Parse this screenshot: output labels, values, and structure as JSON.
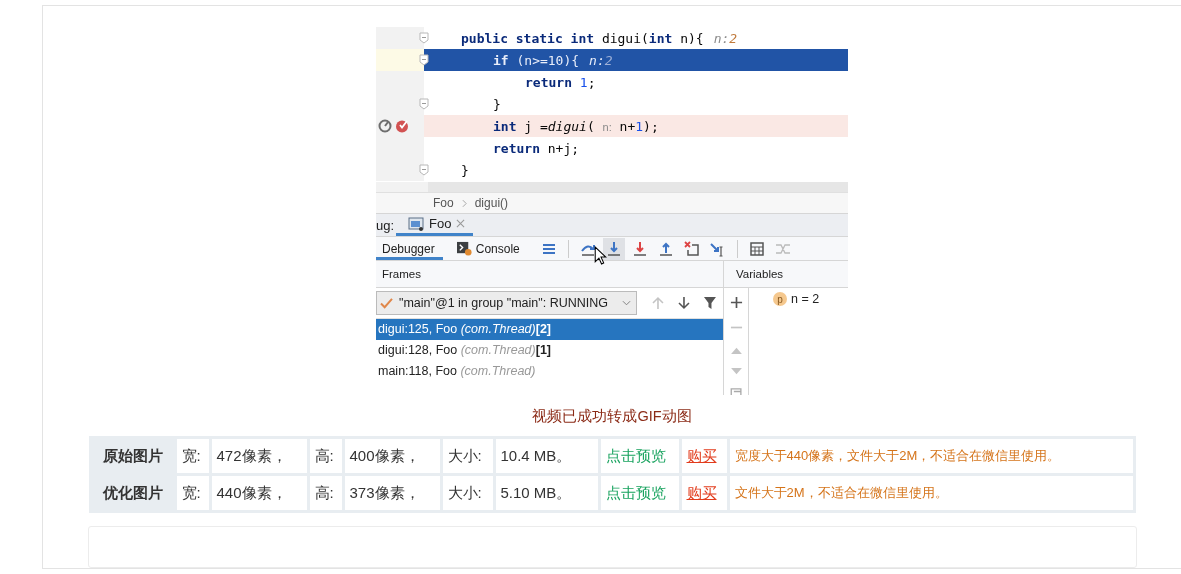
{
  "gif": {
    "code_lines": [
      {
        "current": false,
        "breakpoint": false,
        "fold": true,
        "segments": [
          {
            "kind": "kw",
            "text": "public static int"
          },
          {
            "kind": "plain",
            "text": " digui("
          },
          {
            "kind": "kw",
            "text": "int"
          },
          {
            "kind": "plain",
            "text": " n){"
          }
        ],
        "hint": [
          {
            "kind": "hint_name",
            "text": "n:"
          },
          {
            "kind": "hint_value",
            "text": "2"
          }
        ],
        "children": [
          {
            "current": true,
            "breakpoint": false,
            "fold": true,
            "segments": [
              {
                "kind": "kw",
                "text": "if"
              },
              {
                "kind": "plain",
                "text": " (n>=10){"
              }
            ],
            "hint": [
              {
                "kind": "hint_name",
                "text": "n:"
              },
              {
                "kind": "hint_value",
                "text": "2"
              }
            ],
            "children": [
              {
                "current": false,
                "breakpoint": false,
                "fold": false,
                "segments": [
                  {
                    "kind": "kw",
                    "text": "return"
                  },
                  {
                    "kind": "num",
                    "text": " 1"
                  },
                  {
                    "kind": "plain",
                    "text": ";"
                  }
                ]
              }
            ]
          },
          {
            "current": false,
            "breakpoint": false,
            "fold": true,
            "segments": [
              {
                "kind": "plain",
                "text": "}"
              }
            ]
          },
          {
            "current": false,
            "breakpoint": true,
            "fold": false,
            "segments": [
              {
                "kind": "kw",
                "text": "int"
              },
              {
                "kind": "plain",
                "text": " j ="
              },
              {
                "kind": "call",
                "text": "digui"
              },
              {
                "kind": "plain",
                "text": "( "
              },
              {
                "kind": "param",
                "text": "n:"
              },
              {
                "kind": "plain",
                "text": " n+"
              },
              {
                "kind": "num",
                "text": "1"
              },
              {
                "kind": "plain",
                "text": ");"
              }
            ]
          },
          {
            "current": false,
            "breakpoint": false,
            "fold": false,
            "segments": [
              {
                "kind": "kw",
                "text": "return"
              },
              {
                "kind": "plain",
                "text": " n+j;"
              }
            ]
          }
        ]
      },
      {
        "current": false,
        "breakpoint": false,
        "fold": true,
        "segments": [
          {
            "kind": "plain",
            "text": "}"
          }
        ]
      }
    ],
    "breadcrumb": [
      "Foo",
      "digui()"
    ],
    "debug_label": "ug:",
    "debug_tab": {
      "label": "Foo",
      "selected": true
    },
    "toolbar_tabs": [
      {
        "label": "Debugger",
        "selected": true,
        "kind": "plain"
      },
      {
        "label": "Console",
        "selected": false,
        "kind": "console"
      }
    ],
    "frames_header": "Frames",
    "variables_header": "Variables",
    "thread": "\"main\"@1 in group \"main\": RUNNING",
    "frames": [
      {
        "method": "digui:125, Foo",
        "package": "(com.Thread)",
        "depth": "[2]",
        "selected": true
      },
      {
        "method": "digui:128, Foo",
        "package": "(com.Thread)",
        "depth": "[1]",
        "selected": false
      },
      {
        "method": "main:118, Foo",
        "package": "(com.Thread)",
        "selected": false
      }
    ],
    "variables": [
      {
        "badge": "p",
        "text": "n = 2"
      }
    ]
  },
  "caption": "视频已成功转成GIF动图",
  "table": {
    "rows": [
      {
        "label": "原始图片",
        "width_label": "宽:",
        "width": "472像素，",
        "height_label": "高:",
        "height": "400像素，",
        "size_label": "大小:",
        "size": "10.4 MB。",
        "preview": "点击预览",
        "buy": "购买",
        "note": "宽度大于440像素，文件大于2M，不适合在微信里使用。"
      },
      {
        "label": "优化图片",
        "width_label": "宽:",
        "width": "440像素，",
        "height_label": "高:",
        "height": "373像素，",
        "size_label": "大小:",
        "size": "5.10 MB。",
        "preview": "点击预览",
        "buy": "购买",
        "note": "文件大于2M，不适合在微信里使用。"
      }
    ]
  }
}
